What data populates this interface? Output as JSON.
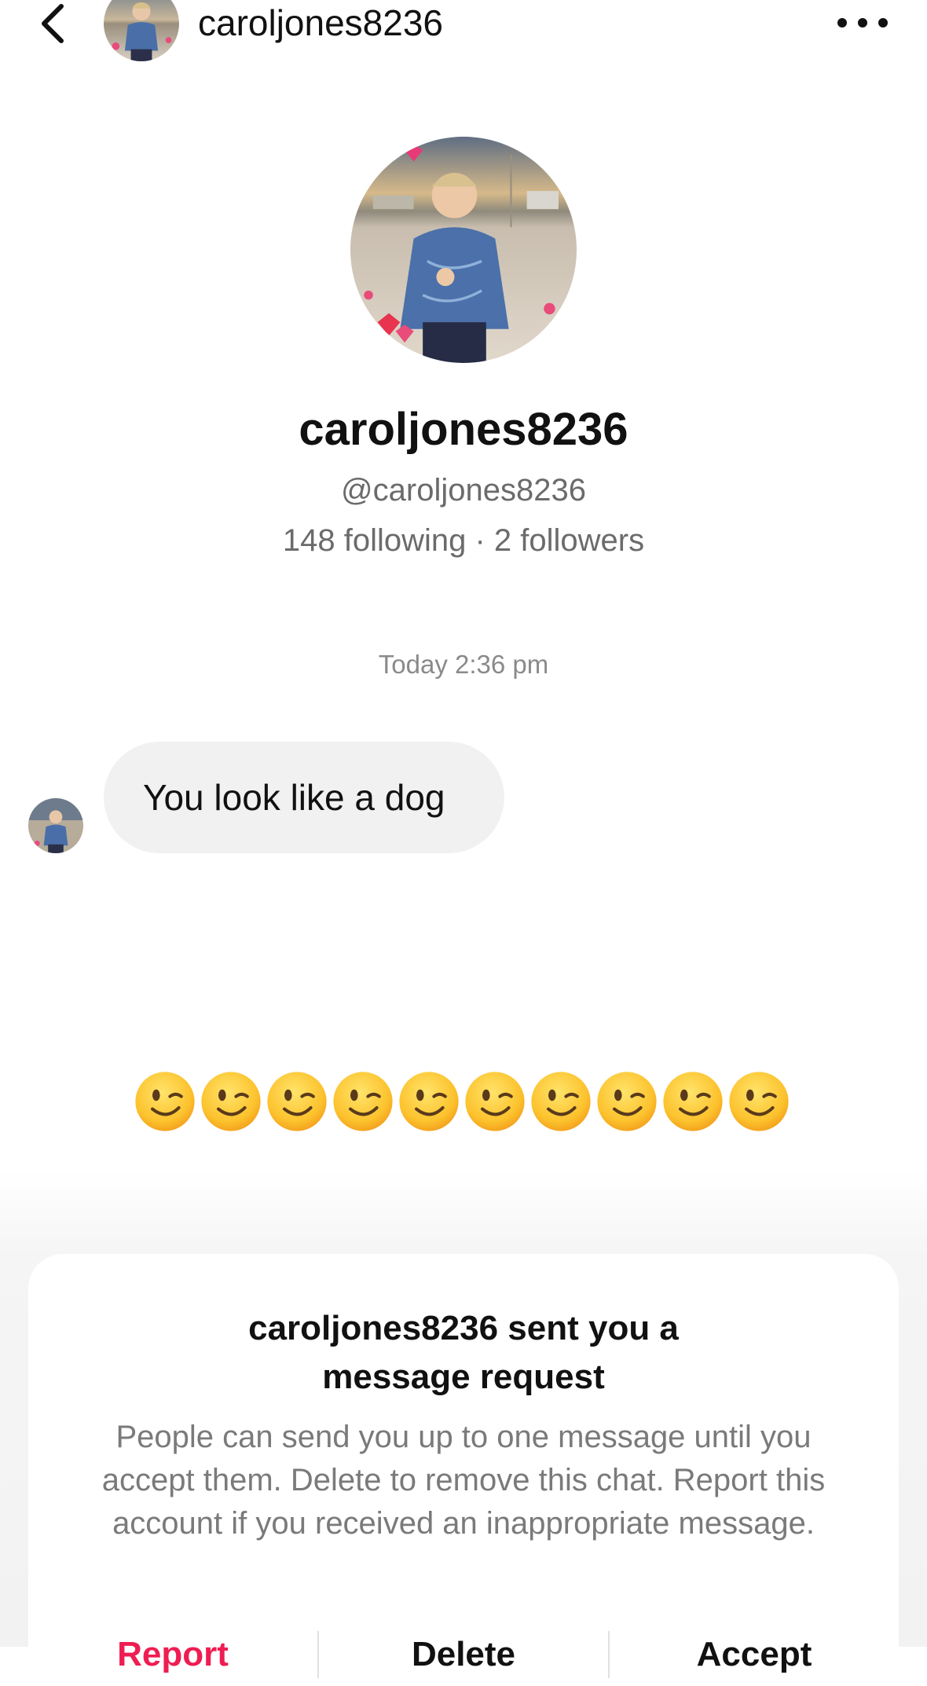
{
  "header": {
    "username": "caroljones8236"
  },
  "profile": {
    "display_name": "caroljones8236",
    "handle": "@caroljones8236",
    "stats": "148 following · 2 followers"
  },
  "conversation": {
    "timestamp": "Today 2:36 pm",
    "message": "You look like a dog",
    "emoji_count": 10
  },
  "request": {
    "title_line1": "caroljones8236 sent you a",
    "title_line2": "message request",
    "body": "People can send you up to one message until you accept them. Delete to remove this chat. Report this account if you received an inappropriate message.",
    "report_label": "Report",
    "delete_label": "Delete",
    "accept_label": "Accept"
  },
  "colors": {
    "report": "#ee1d52",
    "bubble": "#f1f1f2",
    "secondary_text": "#6b6b6b"
  },
  "icons": [
    "back-icon",
    "more-icon",
    "wink-emoji-icon"
  ]
}
